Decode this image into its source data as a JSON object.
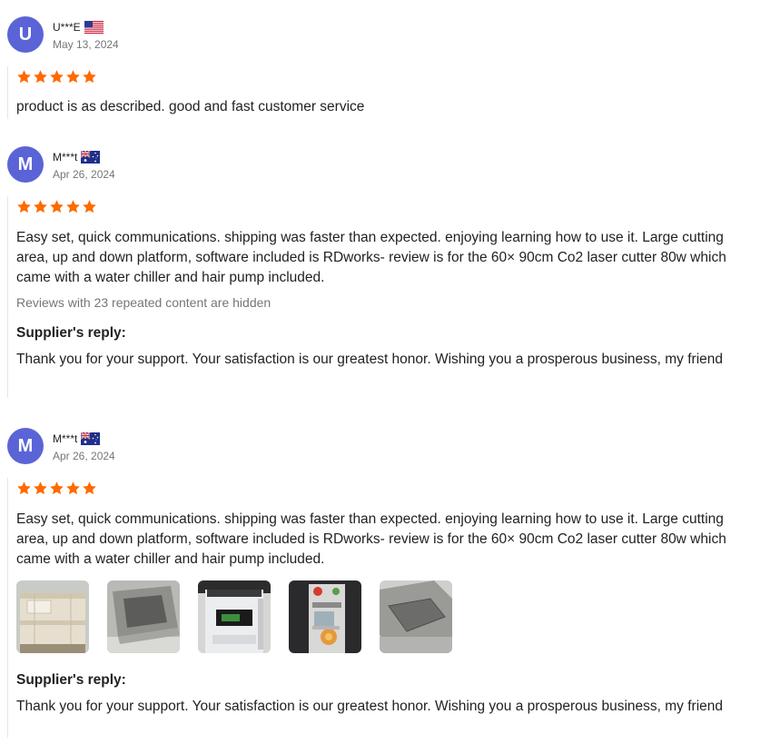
{
  "reviews": [
    {
      "avatar_letter": "U",
      "name": "U***E",
      "country_flag": "us-flag",
      "date": "May 13, 2024",
      "rating": 5,
      "text": "product is as described. good and fast customer service"
    },
    {
      "avatar_letter": "M",
      "name": "M***t",
      "country_flag": "au-flag",
      "date": "Apr 26, 2024",
      "rating": 5,
      "text": "Easy set, quick communications. shipping was faster than expected. enjoying learning how to use it. Large cutting area, up and down platform, software included is RDworks- review is for the 60× 90cm Co2 laser cutter 80w which came with a water chiller and hair pump included.",
      "hidden_note": "Reviews with 23 repeated content are hidden",
      "reply_title": "Supplier's reply:",
      "reply_text": "Thank you for your support. Your satisfaction is our greatest honor. Wishing you a prosperous business, my friend"
    },
    {
      "avatar_letter": "M",
      "name": "M***t",
      "country_flag": "au-flag",
      "date": "Apr 26, 2024",
      "rating": 5,
      "text": "Easy set, quick communications. shipping was faster than expected. enjoying learning how to use it. Large cutting area, up and down platform, software included is RDworks- review is for the 60× 90cm Co2 laser cutter 80w which came with a water chiller and hair pump included.",
      "photos": [
        "crate-photo",
        "laser-cutter-top-photo",
        "water-chiller-photo",
        "control-panel-photo",
        "laser-bed-photo"
      ],
      "reply_title": "Supplier's reply:",
      "reply_text": "Thank you for your support. Your satisfaction is our greatest honor. Wishing you a prosperous business, my friend"
    }
  ],
  "colors": {
    "avatar": "#5a64d7",
    "star": "#ff6a00",
    "muted": "#767676"
  }
}
